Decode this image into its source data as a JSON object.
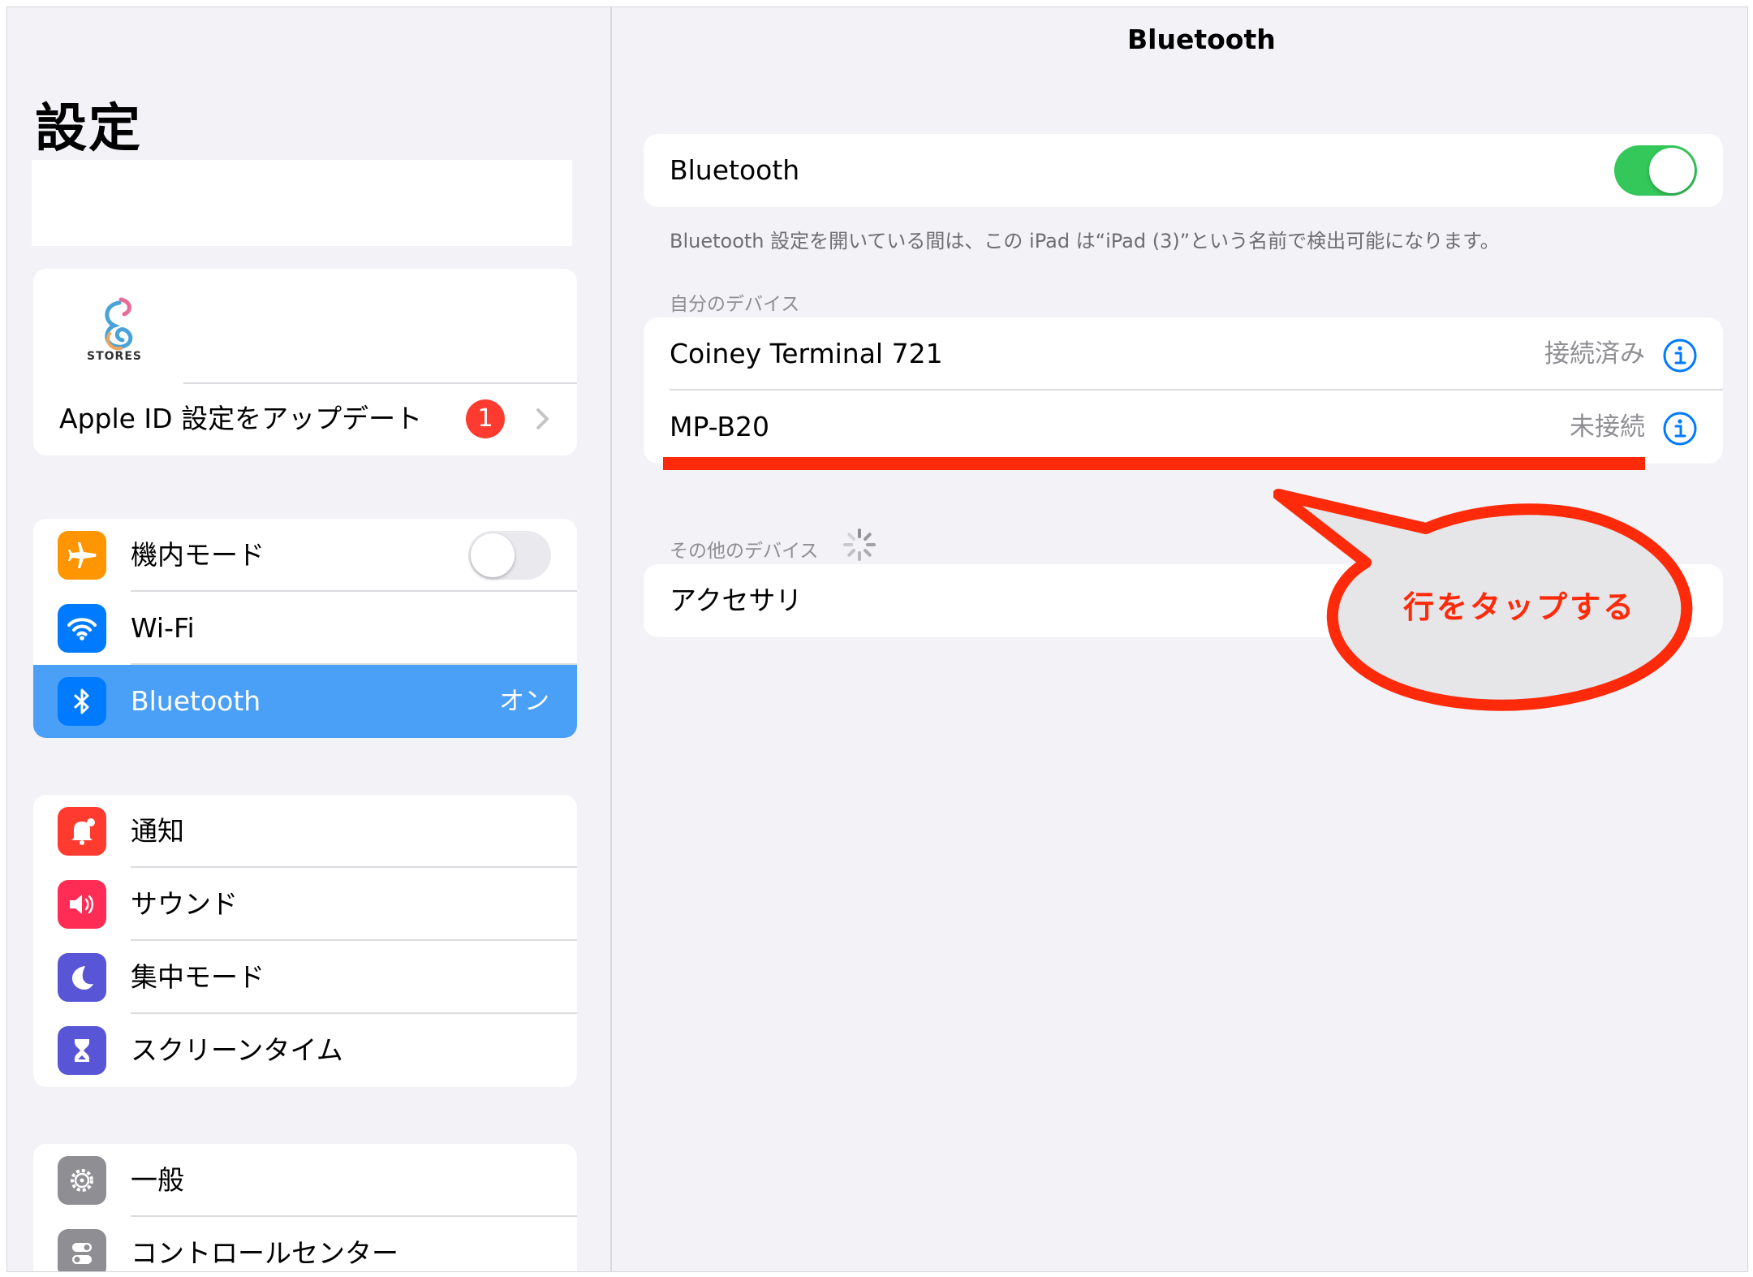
{
  "sidebar": {
    "title": "設定",
    "stores_text": "STORES",
    "apple_id": {
      "label": "Apple ID 設定をアップデート",
      "badge": "1"
    },
    "group1": [
      {
        "label": "機内モード",
        "icon": "airplane-icon",
        "color": "#ff9500"
      },
      {
        "label": "Wi-Fi",
        "icon": "wifi-icon",
        "color": "#007aff"
      },
      {
        "label": "Bluetooth",
        "icon": "bluetooth-icon",
        "color": "#007aff",
        "value": "オン",
        "selected": true
      }
    ],
    "group2": [
      {
        "label": "通知",
        "icon": "bell-icon",
        "color": "#ff3b30"
      },
      {
        "label": "サウンド",
        "icon": "speaker-icon",
        "color": "#ff2d55"
      },
      {
        "label": "集中モード",
        "icon": "moon-icon",
        "color": "#5856d6"
      },
      {
        "label": "スクリーンタイム",
        "icon": "hourglass-icon",
        "color": "#5856d6"
      }
    ],
    "group3": [
      {
        "label": "一般",
        "icon": "gear-icon",
        "color": "#8e8e93"
      },
      {
        "label": "コントロールセンター",
        "icon": "switches-icon",
        "color": "#8e8e93"
      }
    ]
  },
  "detail": {
    "nav_title": "Bluetooth",
    "bluetooth_row": {
      "label": "Bluetooth",
      "enabled": true
    },
    "footnote": "Bluetooth 設定を開いている間は、この iPad は“iPad (3)”という名前で検出可能になります。",
    "my_devices_header": "自分のデバイス",
    "my_devices": [
      {
        "name": "Coiney Terminal 721",
        "status": "接続済み"
      },
      {
        "name": "MP-B20",
        "status": "未接続"
      }
    ],
    "other_devices_header": "その他のデバイス",
    "other_devices": [
      {
        "name": "アクセサリ"
      }
    ]
  },
  "annotation": {
    "callout_text": "行をタップする",
    "color": "#ff2a0a"
  },
  "colors": {
    "accent": "#007aff",
    "toggle_on": "#34c759",
    "selected_row": "#4a9ff6",
    "background": "#f2f2f7"
  }
}
